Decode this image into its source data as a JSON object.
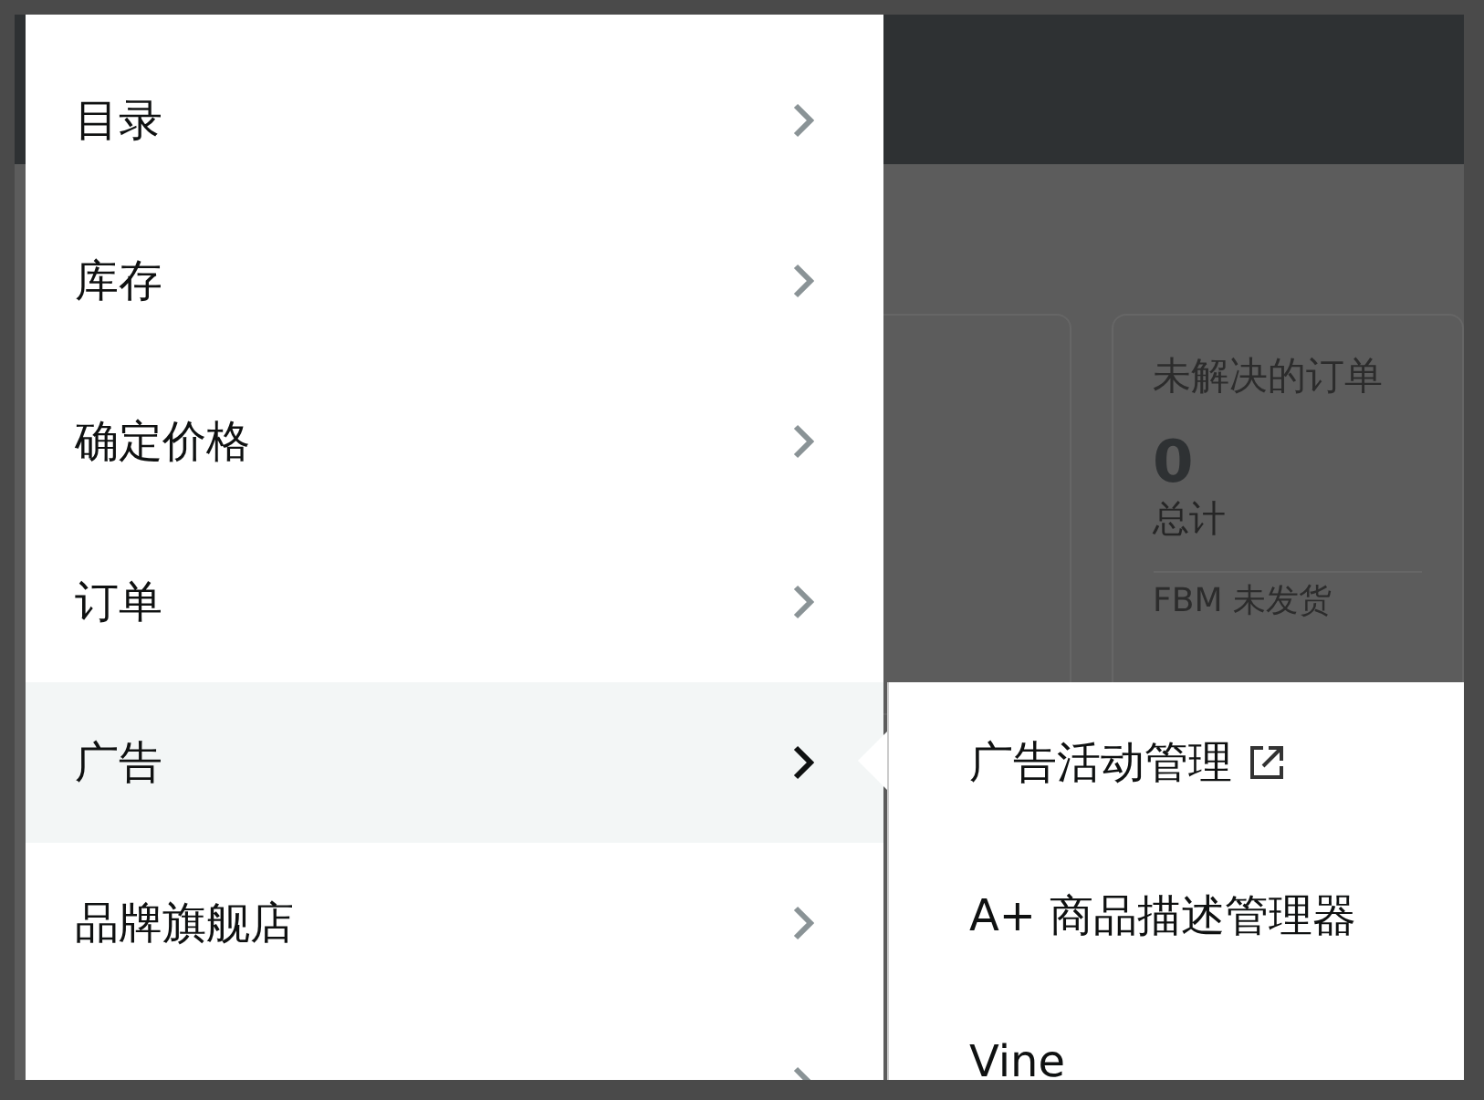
{
  "menu": {
    "items": [
      {
        "label": "目录",
        "selected": false
      },
      {
        "label": "库存",
        "selected": false
      },
      {
        "label": "确定价格",
        "selected": false
      },
      {
        "label": "订单",
        "selected": false
      },
      {
        "label": "广告",
        "selected": true
      },
      {
        "label": "品牌旗舰店",
        "selected": false
      },
      {
        "selected": false
      }
    ]
  },
  "submenu": {
    "items": [
      {
        "label": "广告活动管理",
        "external": true
      },
      {
        "label": "A+ 商品描述管理器",
        "external": false
      },
      {
        "label": "Vine",
        "external": false
      }
    ]
  },
  "background": {
    "card": {
      "title": "未解决的订单",
      "value": "0",
      "caption": "总计",
      "footer": "FBM 未发货"
    }
  }
}
